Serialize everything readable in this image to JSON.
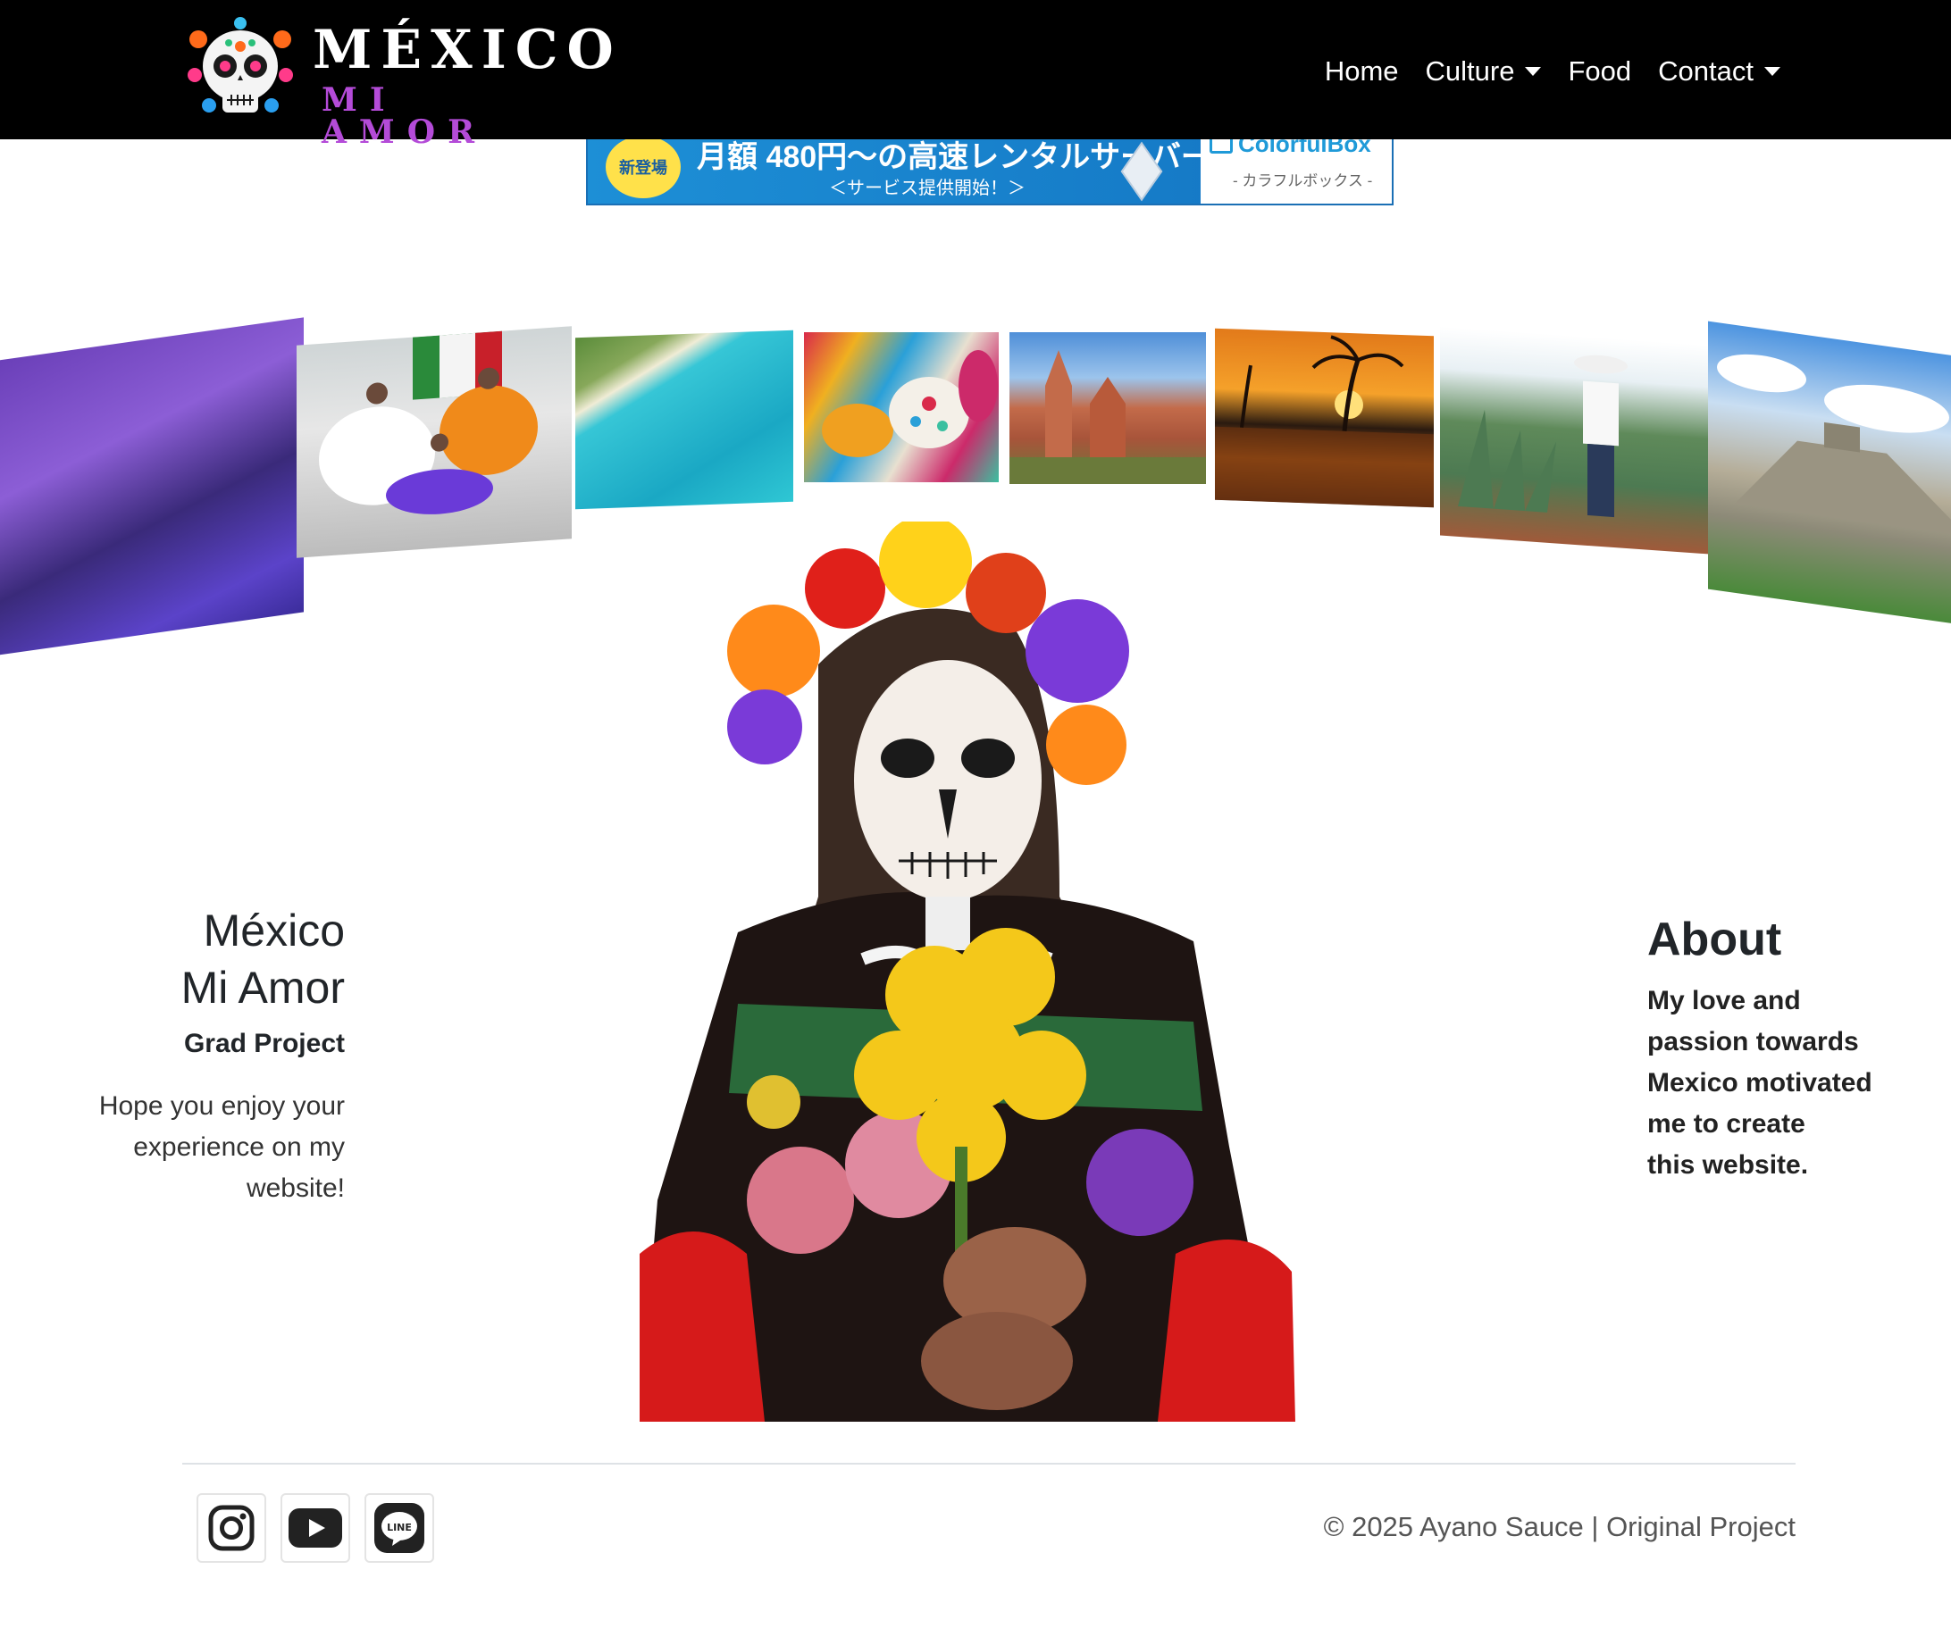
{
  "brand": {
    "title": "MÉXICO",
    "subtitle": "MI AMOR"
  },
  "nav": {
    "items": [
      {
        "label": "Home",
        "dropdown": false
      },
      {
        "label": "Culture",
        "dropdown": true
      },
      {
        "label": "Food",
        "dropdown": false
      },
      {
        "label": "Contact",
        "dropdown": true
      }
    ]
  },
  "banner": {
    "badge": "新登場",
    "main": "月額 480円〜の高速レンタルサーバー",
    "sub": "＜サービス提供開始！＞",
    "brand_name": "ColorfulBox",
    "brand_jp": "- カラフルボックス -",
    "colors": {
      "background": "#1d8fd6",
      "badge": "#ffe14a",
      "brand": "#1f9ad8"
    }
  },
  "carousel": {
    "photos": [
      {
        "name": "jacaranda-trees-photo"
      },
      {
        "name": "folklorico-dancers-photo"
      },
      {
        "name": "caribbean-beach-photo"
      },
      {
        "name": "alebrijes-photo"
      },
      {
        "name": "san-miguel-church-photo"
      },
      {
        "name": "palm-sunset-photo"
      },
      {
        "name": "agave-harvest-photo"
      },
      {
        "name": "chichen-itza-pyramid-photo"
      }
    ]
  },
  "hero": {
    "title_line1": "México",
    "title_line2": "Mi Amor",
    "subtitle": "Grad Project",
    "desc_line1": "Hope you enjoy your",
    "desc_line2": "experience on my",
    "desc_line3": "website!"
  },
  "about": {
    "title": "About",
    "line1": "My love and",
    "line2": "passion towards",
    "line3": "Mexico motivated",
    "line4": "me to create",
    "line5": "this website."
  },
  "footer": {
    "social": [
      {
        "icon": "instagram-icon"
      },
      {
        "icon": "youtube-icon"
      },
      {
        "icon": "line-icon"
      }
    ],
    "copyright": "© 2025 Ayano Sauce | Original Project"
  },
  "colors": {
    "navbar": "#000000",
    "brand_subtitle": "#b44bd8",
    "text": "#212529"
  }
}
